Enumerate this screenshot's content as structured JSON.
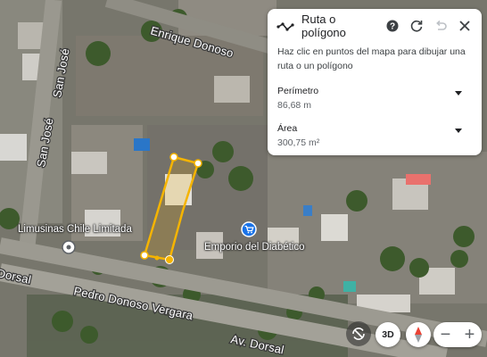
{
  "panel": {
    "title": "Ruta o polígono",
    "instructions": "Haz clic en puntos del mapa para dibujar una ruta o un polígono",
    "perimeter_label": "Perímetro",
    "perimeter_value": "86,68 m",
    "area_label": "Área",
    "area_value": "300,75 m²"
  },
  "map": {
    "streets": [
      "Enrique Donoso",
      "San José",
      "San José",
      "Dorsal",
      "Pedro Donoso Vergara",
      "Av. Dorsal"
    ],
    "places": [
      "Limusinas Chile Limitada",
      "Emporio del Diabético"
    ]
  },
  "controls": {
    "three_d_label": "3D",
    "zoom_out_label": "−",
    "zoom_in_label": "+"
  },
  "colors": {
    "polygon_outline": "#f5b400",
    "polygon_fill": "rgba(245,180,0,0.18)",
    "shopping_pin": "#1a73e8",
    "compass_red": "#ea4335"
  }
}
